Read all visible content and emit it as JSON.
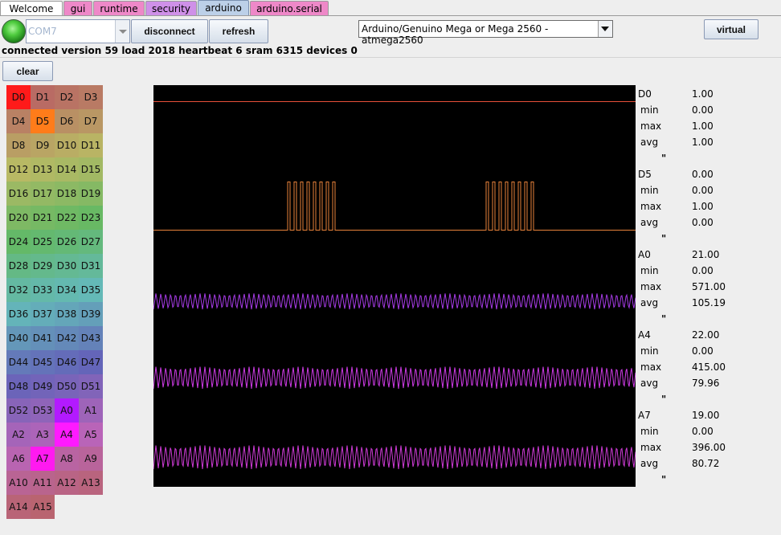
{
  "tabs": [
    {
      "label": "Welcome",
      "bg": "#ffffff",
      "active": false
    },
    {
      "label": "gui",
      "bg": "#ee88c8",
      "active": false
    },
    {
      "label": "runtime",
      "bg": "#ee88c8",
      "active": false
    },
    {
      "label": "security",
      "bg": "#cf90e8",
      "active": false
    },
    {
      "label": "arduino",
      "bg": "#bcd0e8",
      "active": true
    },
    {
      "label": "arduino.serial",
      "bg": "#ee88c8",
      "active": false
    }
  ],
  "toolbar": {
    "port": "COM7",
    "disconnect_label": "disconnect",
    "refresh_label": "refresh",
    "board": "Arduino/Genuino Mega or Mega 2560 - atmega2560",
    "virtual_label": "virtual",
    "clear_label": "clear"
  },
  "status_text": "connected version 59 load 2018 heartbeat 6 sram 6315 devices 0",
  "pins": {
    "labels": [
      "D0",
      "D1",
      "D2",
      "D3",
      "D4",
      "D5",
      "D6",
      "D7",
      "D8",
      "D9",
      "D10",
      "D11",
      "D12",
      "D13",
      "D14",
      "D15",
      "D16",
      "D17",
      "D18",
      "D19",
      "D20",
      "D21",
      "D22",
      "D23",
      "D24",
      "D25",
      "D26",
      "D27",
      "D28",
      "D29",
      "D30",
      "D31",
      "D32",
      "D33",
      "D34",
      "D35",
      "D36",
      "D37",
      "D38",
      "D39",
      "D40",
      "D41",
      "D42",
      "D43",
      "D44",
      "D45",
      "D46",
      "D47",
      "D48",
      "D49",
      "D50",
      "D51",
      "D52",
      "D53",
      "A0",
      "A1",
      "A2",
      "A3",
      "A4",
      "A5",
      "A6",
      "A7",
      "A8",
      "A9",
      "A10",
      "A11",
      "A12",
      "A13",
      "A14",
      "A15"
    ],
    "active": {
      "D0": "#ff1a1a",
      "D5": "#ff7c1a",
      "A0": "#b31aff",
      "A4": "#ff1aff",
      "A7": "#ff1af0"
    }
  },
  "traces": [
    {
      "pin": "D0",
      "value": "1.00",
      "min": "0.00",
      "max": "1.00",
      "avg": "1.00",
      "color": "#e8503a"
    },
    {
      "pin": "D5",
      "value": "0.00",
      "min": "0.00",
      "max": "1.00",
      "avg": "0.00",
      "color": "#e8823a"
    },
    {
      "pin": "A0",
      "value": "21.00",
      "min": "0.00",
      "max": "571.00",
      "avg": "105.19",
      "color": "#a83ce8"
    },
    {
      "pin": "A4",
      "value": "22.00",
      "min": "0.00",
      "max": "415.00",
      "avg": "79.96",
      "color": "#d03ce8"
    },
    {
      "pin": "A7",
      "value": "19.00",
      "min": "0.00",
      "max": "396.00",
      "avg": "80.72",
      "color": "#d03cd8"
    }
  ],
  "stat_labels": {
    "min": "min",
    "max": "max",
    "avg": "avg",
    "mark": "\""
  }
}
